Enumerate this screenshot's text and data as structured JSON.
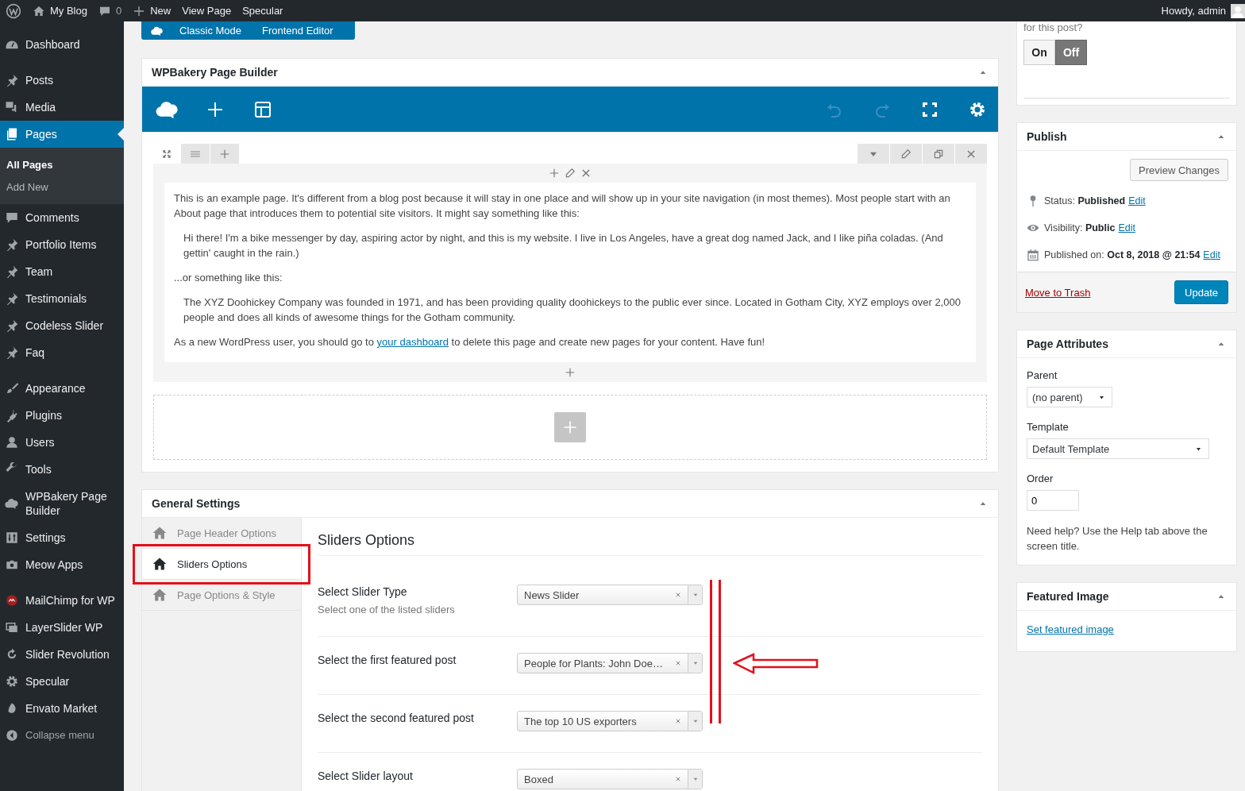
{
  "admin_bar": {
    "site_name": "My Blog",
    "comments_count": "0",
    "new_label": "New",
    "view_label": "View Page",
    "theme_label": "Specular",
    "greeting": "Howdy, admin"
  },
  "sidebar": {
    "groups": [
      [
        {
          "label": "Dashboard",
          "selected": false
        }
      ],
      [
        {
          "label": "Posts",
          "selected": false
        },
        {
          "label": "Media",
          "selected": false
        },
        {
          "label": "Pages",
          "selected": true,
          "submenu": [
            {
              "label": "All Pages",
              "selected": true
            },
            {
              "label": "Add New",
              "selected": false
            }
          ]
        },
        {
          "label": "Comments",
          "selected": false
        },
        {
          "label": "Portfolio Items",
          "selected": false
        },
        {
          "label": "Team",
          "selected": false
        },
        {
          "label": "Testimonials",
          "selected": false
        },
        {
          "label": "Codeless Slider",
          "selected": false
        },
        {
          "label": "Faq",
          "selected": false
        }
      ],
      [
        {
          "label": "Appearance",
          "selected": false
        },
        {
          "label": "Plugins",
          "selected": false
        },
        {
          "label": "Users",
          "selected": false
        },
        {
          "label": "Tools",
          "selected": false
        },
        {
          "label": "WPBakery Page Builder",
          "selected": false
        },
        {
          "label": "Settings",
          "selected": false
        },
        {
          "label": "Meow Apps",
          "selected": false
        }
      ],
      [
        {
          "label": "MailChimp for WP",
          "selected": false
        },
        {
          "label": "LayerSlider WP",
          "selected": false
        },
        {
          "label": "Slider Revolution",
          "selected": false
        },
        {
          "label": "Specular",
          "selected": false
        },
        {
          "label": "Envato Market",
          "selected": false
        }
      ]
    ],
    "collapse_label": "Collapse menu"
  },
  "editor_switch": [
    {
      "label": "Classic Mode",
      "selected": false
    },
    {
      "label": "Frontend Editor",
      "selected": false
    }
  ],
  "page_builder": {
    "title": "WPBakery Page Builder",
    "toolbar": {
      "left": [
        {
          "kind": "logo",
          "disabled": false
        },
        {
          "kind": "add",
          "disabled": false
        },
        {
          "kind": "templates",
          "disabled": false
        }
      ],
      "right": [
        {
          "kind": "undo",
          "disabled": true
        },
        {
          "kind": "redo",
          "disabled": true
        },
        {
          "kind": "fullscreen",
          "disabled": false
        },
        {
          "kind": "settings",
          "disabled": false
        }
      ]
    },
    "paragraphs": [
      {
        "kind": "plain",
        "text": "This is an example page. It's different from a blog post because it will stay in one place and will show up in your site navigation (in most themes). Most people start with an About page that introduces them to potential site visitors. It might say something like this:"
      },
      {
        "kind": "quote",
        "text": "Hi there! I'm a bike messenger by day, aspiring actor by night, and this is my website. I live in Los Angeles, have a great dog named Jack, and I like piña coladas. (And gettin' caught in the rain.)"
      },
      {
        "kind": "plain",
        "text": "...or something like this:"
      },
      {
        "kind": "quote",
        "text": "The XYZ Doohickey Company was founded in 1971, and has been providing quality doohickeys to the public ever since. Located in Gotham City, XYZ employs over 2,000 people and does all kinds of awesome things for the Gotham community."
      },
      {
        "kind": "plain",
        "text": "As a new WordPress user, you should go to ",
        "link": "your dashboard",
        "after": " to delete this page and create new pages for your content. Have fun!"
      }
    ]
  },
  "general_settings": {
    "title": "General Settings",
    "tabs": [
      {
        "label": "Page Header Options",
        "selected": false
      },
      {
        "label": "Sliders Options",
        "selected": true
      },
      {
        "label": "Page Options & Style",
        "selected": false
      }
    ],
    "section_title": "Sliders Options",
    "fields": [
      {
        "label": "Select Slider Type",
        "hint": "Select one of the listed sliders",
        "value": "News Slider"
      },
      {
        "label": "Select the first featured post",
        "value": "People for Plants: John Doe…"
      },
      {
        "label": "Select the second featured post",
        "value": "The top 10 US exporters"
      },
      {
        "label": "Select Slider layout",
        "value": "Boxed"
      }
    ]
  },
  "visibility_box": {
    "question": "for this post?",
    "options": [
      {
        "label": "On",
        "selected": false
      },
      {
        "label": "Off",
        "selected": true
      }
    ]
  },
  "publish": {
    "title": "Publish",
    "preview_label": "Preview Changes",
    "rows": [
      {
        "text": "Status: **Published**",
        "link": "Edit"
      },
      {
        "text": "Visibility: **Public**",
        "link": "Edit"
      },
      {
        "text": "Published on: **Oct 8, 2018 @ 21:54**",
        "link": "Edit"
      }
    ],
    "trash_label": "Move to Trash",
    "update_label": "Update"
  },
  "page_attributes": {
    "title": "Page Attributes",
    "parent_label": "Parent",
    "parent_value": "(no parent)",
    "template_label": "Template",
    "template_value": "Default Template",
    "order_label": "Order",
    "order_value": "0",
    "help": "Need help? Use the Help tab above the screen title."
  },
  "featured_image": {
    "title": "Featured Image",
    "link": "Set featured image"
  }
}
